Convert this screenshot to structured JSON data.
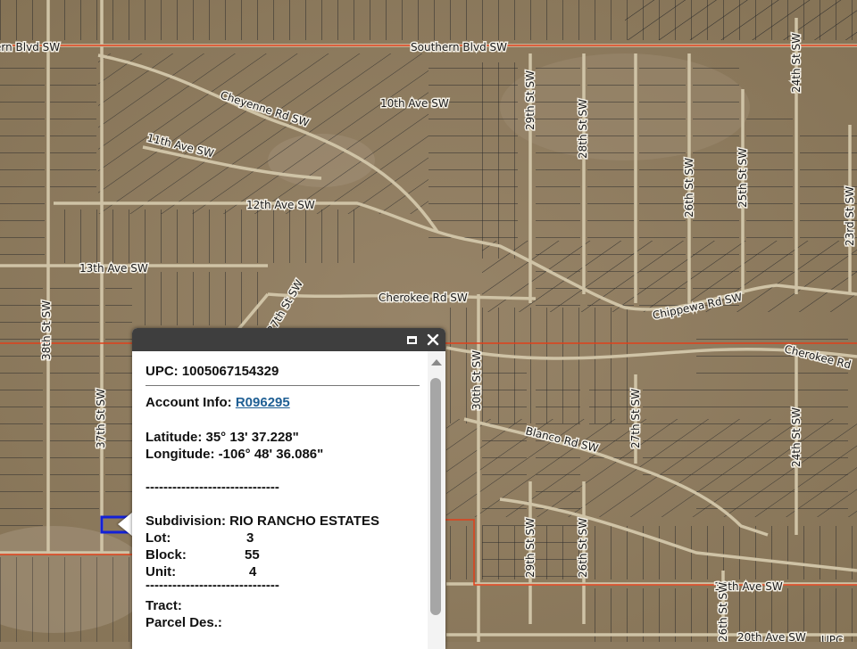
{
  "map": {
    "colors": {
      "terrain": "#8d7b60",
      "parcel_line": "#2a2a2a",
      "road": "#cfc3a6",
      "boundary": "#e0401a",
      "highlight": "#1320d8"
    },
    "streets": [
      {
        "name": "ern Blvd SW"
      },
      {
        "name": "Southern Blvd SW"
      },
      {
        "name": "Cheyenne Rd SW"
      },
      {
        "name": "10th Ave SW"
      },
      {
        "name": "11th Ave SW"
      },
      {
        "name": "12th Ave SW"
      },
      {
        "name": "13th Ave SW"
      },
      {
        "name": "Cherokee Rd SW"
      },
      {
        "name": "Chippewa Rd SW"
      },
      {
        "name": "Cherokee Rd"
      },
      {
        "name": "Blanco Rd SW"
      },
      {
        "name": "38th St SW"
      },
      {
        "name": "37th St SW"
      },
      {
        "name": "30th St SW"
      },
      {
        "name": "29th St SW"
      },
      {
        "name": "28th St SW"
      },
      {
        "name": "27th St SW"
      },
      {
        "name": "26th St SW"
      },
      {
        "name": "25th St SW"
      },
      {
        "name": "24th St SW"
      },
      {
        "name": "23rd St SW"
      },
      {
        "name": "18th Ave SW"
      },
      {
        "name": "20th Ave SW"
      },
      {
        "name": "26th St SW"
      },
      {
        "name": "24th St SW"
      },
      {
        "name": "27th St SW"
      },
      {
        "name": "29th St SW"
      },
      {
        "name": "26th St SW"
      },
      {
        "name": "UPC"
      }
    ]
  },
  "popup": {
    "upc_label": "UPC:",
    "upc_value": "1005067154329",
    "account_label": "Account Info:",
    "account_value": "R096295",
    "latitude_label": "Latitude:",
    "latitude_value": "35° 13' 37.228\"",
    "longitude_label": "Longitude:",
    "longitude_value": "-106° 48' 36.086\"",
    "separator": "------------------------------",
    "subdivision_label": "Subdivision:",
    "subdivision_value": "RIO RANCHO ESTATES",
    "lot_label": "Lot:",
    "lot_value": "3",
    "block_label": "Block:",
    "block_value": "55",
    "unit_label": "Unit:",
    "unit_value": "4",
    "tract_label": "Tract:",
    "parcel_label": "Parcel Des.:"
  }
}
